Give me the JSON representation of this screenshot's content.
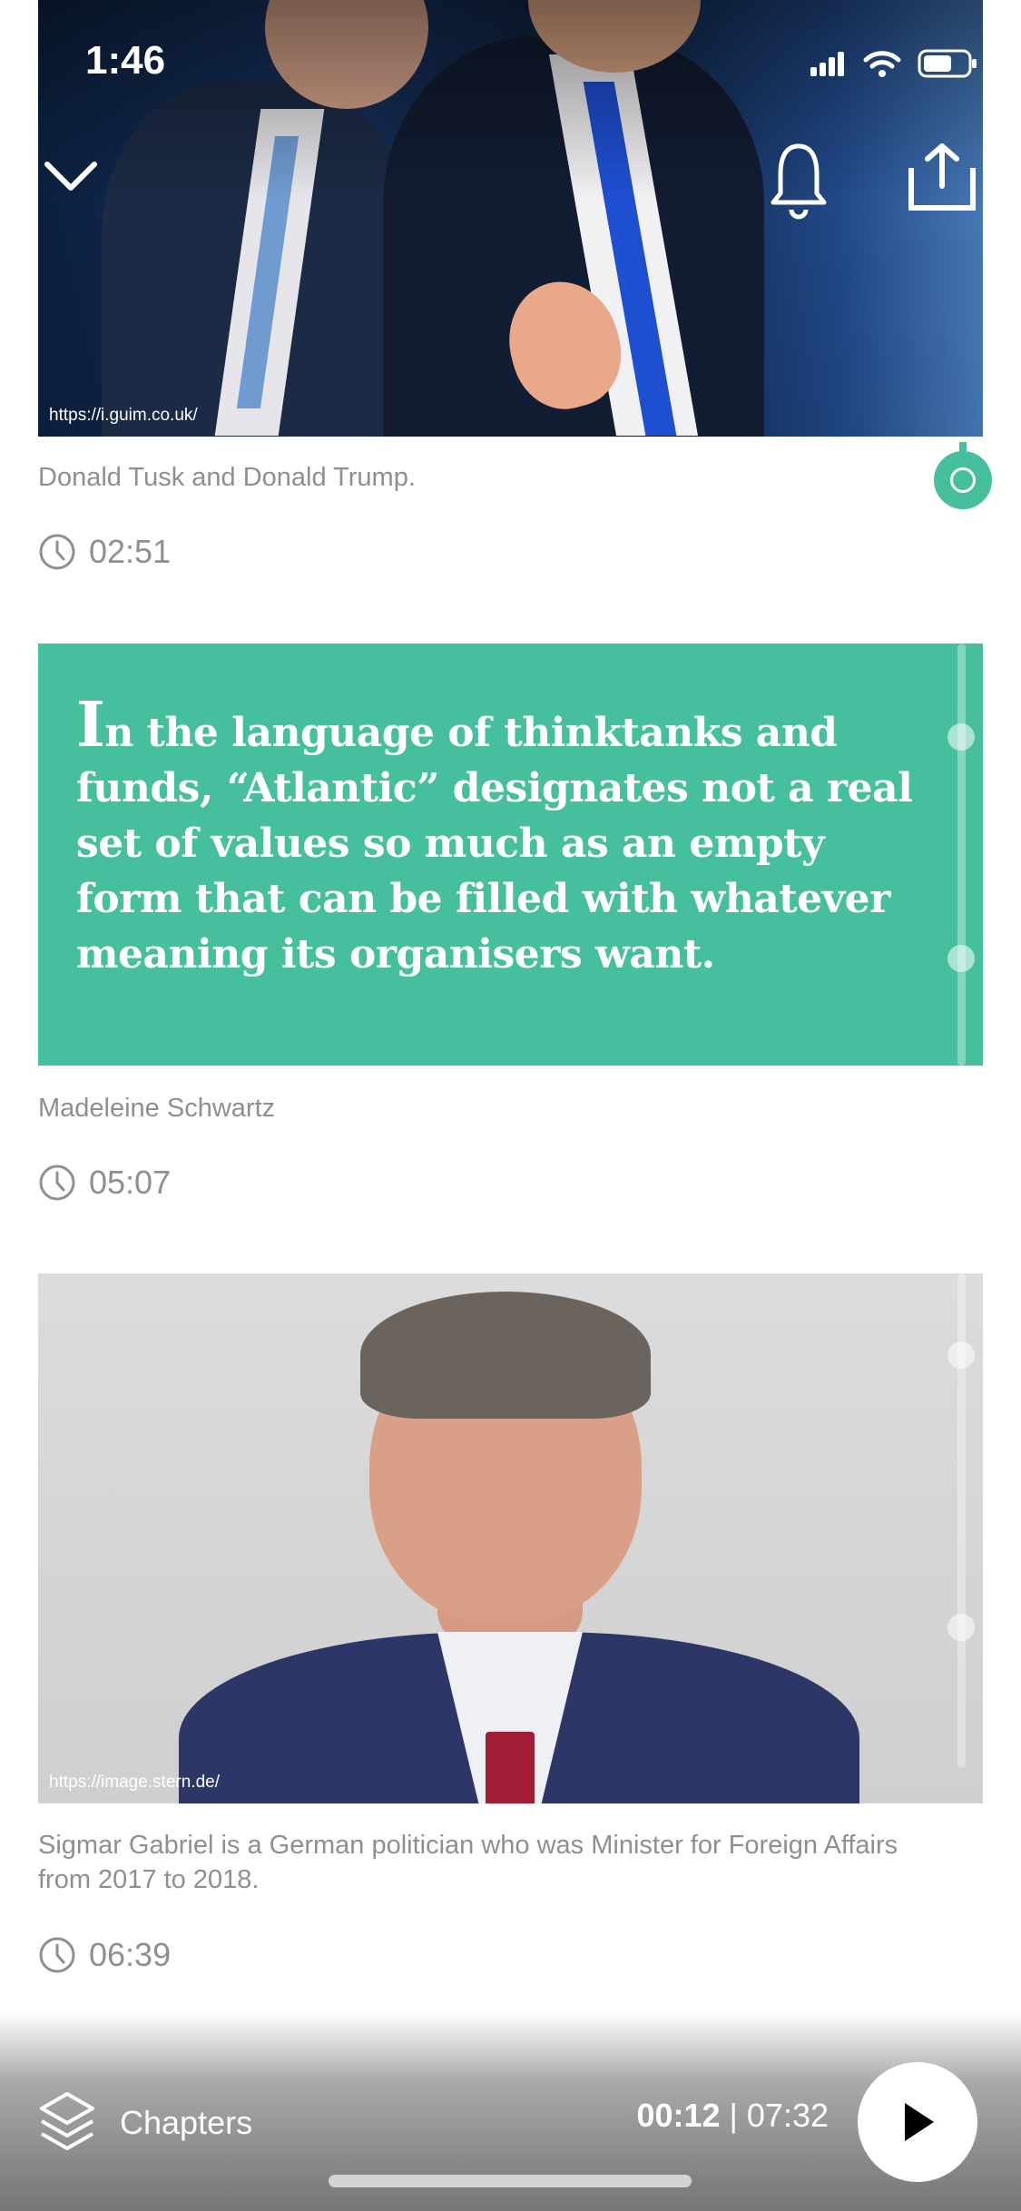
{
  "status_bar": {
    "time": "1:46"
  },
  "sections": [
    {
      "image_source": "https://i.guim.co.uk/",
      "caption": "Donald Tusk and Donald Trump.",
      "duration": "02:51"
    },
    {
      "quote_first_letter": "I",
      "quote_rest": "n the language of thinktanks and funds, “Atlantic” designates not a real set of values so much as an empty form that can be filled with whatever meaning its organisers want.",
      "author": "Madeleine Schwartz",
      "duration": "05:07"
    },
    {
      "image_source": "https://image.stern.de/",
      "caption": "Sigmar Gabriel is a German politician who was Minister for Foreign Affairs from 2017 to 2018.",
      "duration": "06:39"
    }
  ],
  "player": {
    "chapters_label": "Chapters",
    "current_time": "00:12",
    "separator": "|",
    "total_time": "07:32"
  },
  "colors": {
    "accent_green": "#45bf9d",
    "caption_gray": "#8f8f8f"
  },
  "icons": [
    "chevron-down-icon",
    "bell-icon",
    "share-icon",
    "clock-icon",
    "layers-icon",
    "play-icon",
    "wifi-icon",
    "signal-icon",
    "battery-icon"
  ]
}
